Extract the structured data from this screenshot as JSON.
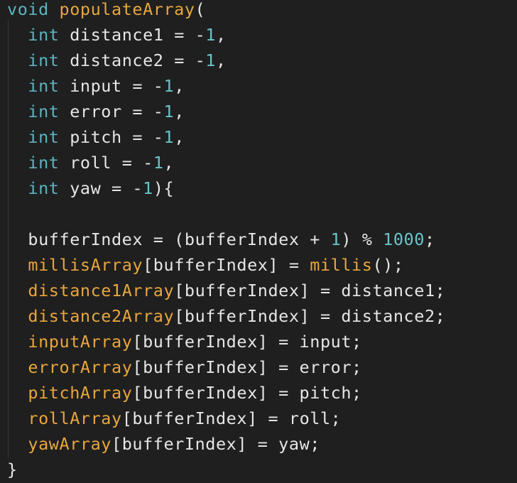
{
  "editor": {
    "lines": [
      [
        {
          "t": "void",
          "c": "kw"
        },
        {
          "t": " ",
          "c": "plain"
        },
        {
          "t": "populateArray",
          "c": "fn"
        },
        {
          "t": "(",
          "c": "plain"
        }
      ],
      [
        {
          "t": "  ",
          "c": "plain"
        },
        {
          "t": "int",
          "c": "kw"
        },
        {
          "t": " distance1 = -",
          "c": "plain"
        },
        {
          "t": "1",
          "c": "num"
        },
        {
          "t": ",",
          "c": "plain"
        }
      ],
      [
        {
          "t": "  ",
          "c": "plain"
        },
        {
          "t": "int",
          "c": "kw"
        },
        {
          "t": " distance2 = -",
          "c": "plain"
        },
        {
          "t": "1",
          "c": "num"
        },
        {
          "t": ",",
          "c": "plain"
        }
      ],
      [
        {
          "t": "  ",
          "c": "plain"
        },
        {
          "t": "int",
          "c": "kw"
        },
        {
          "t": " input = -",
          "c": "plain"
        },
        {
          "t": "1",
          "c": "num"
        },
        {
          "t": ",",
          "c": "plain"
        }
      ],
      [
        {
          "t": "  ",
          "c": "plain"
        },
        {
          "t": "int",
          "c": "kw"
        },
        {
          "t": " error = -",
          "c": "plain"
        },
        {
          "t": "1",
          "c": "num"
        },
        {
          "t": ",",
          "c": "plain"
        }
      ],
      [
        {
          "t": "  ",
          "c": "plain"
        },
        {
          "t": "int",
          "c": "kw"
        },
        {
          "t": " pitch = -",
          "c": "plain"
        },
        {
          "t": "1",
          "c": "num"
        },
        {
          "t": ",",
          "c": "plain"
        }
      ],
      [
        {
          "t": "  ",
          "c": "plain"
        },
        {
          "t": "int",
          "c": "kw"
        },
        {
          "t": " roll = -",
          "c": "plain"
        },
        {
          "t": "1",
          "c": "num"
        },
        {
          "t": ",",
          "c": "plain"
        }
      ],
      [
        {
          "t": "  ",
          "c": "plain"
        },
        {
          "t": "int",
          "c": "kw"
        },
        {
          "t": " yaw = -",
          "c": "plain"
        },
        {
          "t": "1",
          "c": "num"
        },
        {
          "t": "){",
          "c": "plain"
        }
      ],
      [],
      [
        {
          "t": "  bufferIndex = (bufferIndex + ",
          "c": "plain"
        },
        {
          "t": "1",
          "c": "num"
        },
        {
          "t": ") % ",
          "c": "plain"
        },
        {
          "t": "1000",
          "c": "num"
        },
        {
          "t": ";",
          "c": "plain"
        }
      ],
      [
        {
          "t": "  ",
          "c": "plain"
        },
        {
          "t": "millisArray",
          "c": "fn"
        },
        {
          "t": "[bufferIndex] = ",
          "c": "plain"
        },
        {
          "t": "millis",
          "c": "fn"
        },
        {
          "t": "();",
          "c": "plain"
        }
      ],
      [
        {
          "t": "  ",
          "c": "plain"
        },
        {
          "t": "distance1Array",
          "c": "fn"
        },
        {
          "t": "[bufferIndex] = distance1;",
          "c": "plain"
        }
      ],
      [
        {
          "t": "  ",
          "c": "plain"
        },
        {
          "t": "distance2Array",
          "c": "fn"
        },
        {
          "t": "[bufferIndex] = distance2;",
          "c": "plain"
        }
      ],
      [
        {
          "t": "  ",
          "c": "plain"
        },
        {
          "t": "inputArray",
          "c": "fn"
        },
        {
          "t": "[bufferIndex] = input;",
          "c": "plain"
        }
      ],
      [
        {
          "t": "  ",
          "c": "plain"
        },
        {
          "t": "errorArray",
          "c": "fn"
        },
        {
          "t": "[bufferIndex] = error;",
          "c": "plain"
        }
      ],
      [
        {
          "t": "  ",
          "c": "plain"
        },
        {
          "t": "pitchArray",
          "c": "fn"
        },
        {
          "t": "[bufferIndex] = pitch;",
          "c": "plain"
        }
      ],
      [
        {
          "t": "  ",
          "c": "plain"
        },
        {
          "t": "rollArray",
          "c": "fn"
        },
        {
          "t": "[bufferIndex] = roll;",
          "c": "plain"
        }
      ],
      [
        {
          "t": "  ",
          "c": "plain"
        },
        {
          "t": "yawArray",
          "c": "fn"
        },
        {
          "t": "[bufferIndex] = yaw;",
          "c": "plain"
        }
      ],
      [
        {
          "t": "}",
          "c": "plain"
        }
      ]
    ]
  },
  "colors": {
    "background": "#1f1f1f",
    "keyword": "#5eb3bf",
    "identifier": "#e8a63d",
    "number": "#6cc3c7",
    "text": "#e6e6e6"
  }
}
